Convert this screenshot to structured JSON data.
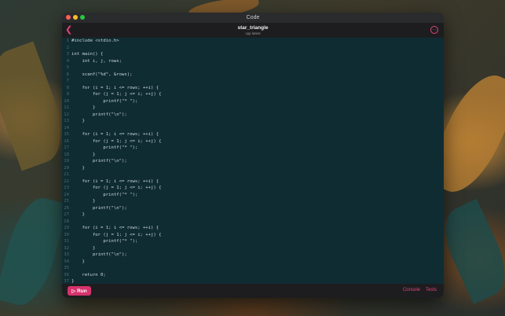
{
  "window": {
    "title": "Code",
    "lights": [
      "#ff5f57",
      "#febc2e",
      "#28c840"
    ]
  },
  "toolbar": {
    "doc_title": "star_triangle",
    "doc_subtitle": "cpp latest",
    "back_icon": "chevron-left-icon",
    "more_icon": "ellipsis-circle-icon"
  },
  "editor": {
    "line_numbers": [
      "1",
      "2",
      "3",
      "4",
      "5",
      "6",
      "7",
      "8",
      "9",
      "10",
      "11",
      "12",
      "13",
      "14",
      "15",
      "16",
      "17",
      "18",
      "19",
      "20",
      "21",
      "22",
      "23",
      "24",
      "25",
      "26",
      "27",
      "28",
      "29",
      "30",
      "31",
      "32",
      "33",
      "34",
      "35",
      "36",
      "37"
    ],
    "lines": [
      "#include <stdio.h>",
      "",
      "int main() {",
      "    int i, j, rows;",
      "",
      "    scanf(\"%d\", &rows);",
      "",
      "    for (i = 1; i <= rows; ++i) {",
      "        for (j = 1; j <= i; ++j) {",
      "            printf(\"* \");",
      "        }",
      "        printf(\"\\n\");",
      "    }",
      "",
      "    for (i = 1; i <= rows; ++i) {",
      "        for (j = 1; j <= i; ++j) {",
      "            printf(\"* \");",
      "        }",
      "        printf(\"\\n\");",
      "    }",
      "",
      "    for (i = 1; i <= rows; ++i) {",
      "        for (j = 1; j <= i; ++j) {",
      "            printf(\"* \");",
      "        }",
      "        printf(\"\\n\");",
      "    }",
      "",
      "    for (i = 1; i <= rows; ++i) {",
      "        for (j = 1; j <= i; ++j) {",
      "            printf(\"* \");",
      "        }",
      "        printf(\"\\n\");",
      "    }",
      "",
      "    return 0;",
      "}"
    ]
  },
  "bottombar": {
    "run_label": "Run",
    "run_icon": "play-icon",
    "console_label": "Console",
    "tests_label": "Tests"
  },
  "colors": {
    "accent": "#e0457b",
    "run_button": "#d6336c",
    "editor_bg": "#0f2c33"
  }
}
